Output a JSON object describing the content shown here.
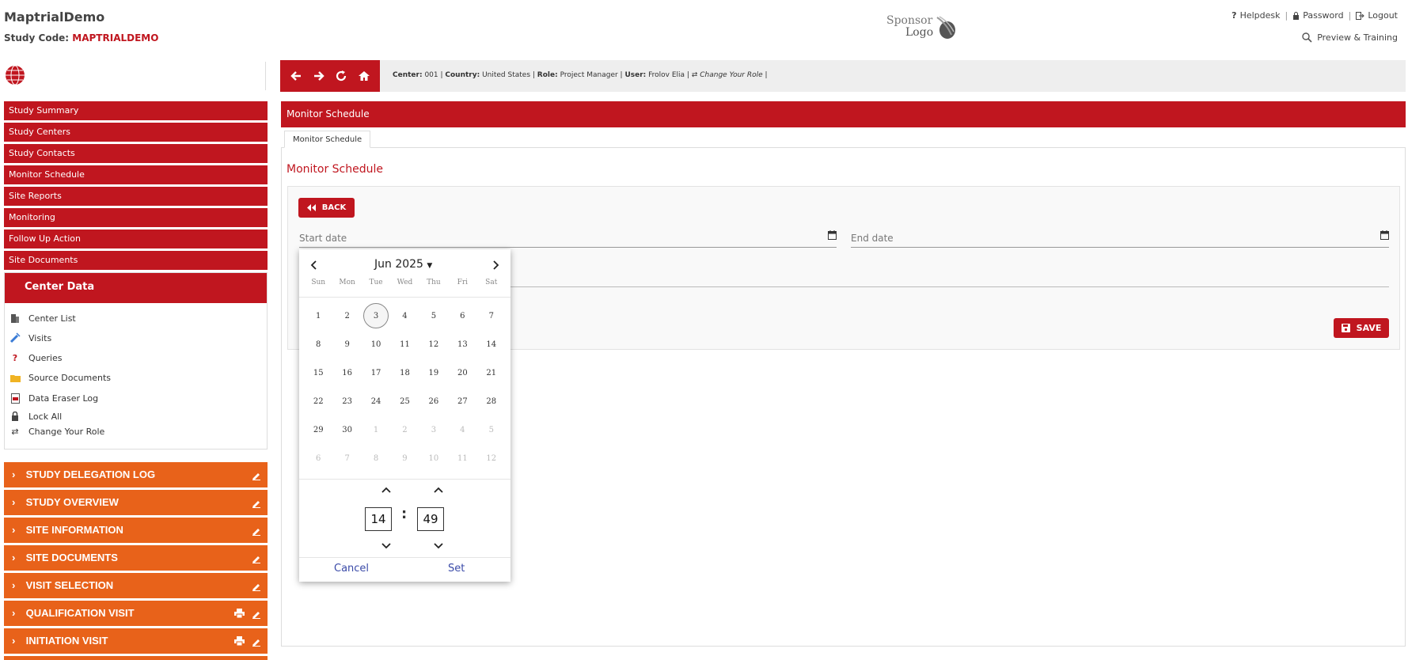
{
  "header": {
    "app_title": "MaptrialDemo",
    "study_code_label": "Study Code:",
    "study_code": "MAPTRIALDEMO",
    "sponsor_line1": "Sponsor",
    "sponsor_line2": "Logo",
    "links": {
      "helpdesk": "Helpdesk",
      "password": "Password",
      "logout": "Logout"
    },
    "preview": "Preview & Training"
  },
  "toolbar": {
    "center_label": "Center:",
    "center": "001",
    "country_label": "Country:",
    "country": "United States",
    "role_label": "Role:",
    "role": "Project Manager",
    "user_label": "User:",
    "user": "Frolov Elia",
    "change_role": "Change Your Role"
  },
  "sidebar": {
    "items": [
      {
        "label": "Study Summary"
      },
      {
        "label": "Study Centers"
      },
      {
        "label": "Study Contacts"
      },
      {
        "label": "Monitor Schedule"
      },
      {
        "label": "Site Reports"
      },
      {
        "label": "Monitoring"
      },
      {
        "label": "Follow Up Action"
      },
      {
        "label": "Site Documents"
      }
    ],
    "center_data": {
      "title": "Center Data",
      "items": [
        {
          "label": "Center List",
          "icon": "building-icon"
        },
        {
          "label": "Visits",
          "icon": "syringe-icon"
        },
        {
          "label": "Queries",
          "icon": "question-icon"
        },
        {
          "label": "Source Documents",
          "icon": "folder-icon"
        },
        {
          "label": "Data Eraser Log",
          "icon": "pdf-icon"
        },
        {
          "label": "Lock All",
          "icon": "lock-icon"
        },
        {
          "label": "Change Your Role",
          "icon": "exchange-icon"
        }
      ]
    },
    "sections": [
      {
        "label": "STUDY DELEGATION LOG"
      },
      {
        "label": "STUDY OVERVIEW"
      },
      {
        "label": "SITE INFORMATION"
      },
      {
        "label": "SITE DOCUMENTS"
      },
      {
        "label": "VISIT SELECTION"
      },
      {
        "label": "QUALIFICATION VISIT"
      },
      {
        "label": "INITIATION VISIT"
      }
    ]
  },
  "main": {
    "header": "Monitor Schedule",
    "tab": "Monitor Schedule",
    "section_title": "Monitor Schedule",
    "back_label": "BACK",
    "start_date_placeholder": "Start date",
    "end_date_placeholder": "End date",
    "save_label": "SAVE"
  },
  "datepicker": {
    "month_label": "Jun 2025",
    "weekdays": [
      "Sun",
      "Mon",
      "Tue",
      "Wed",
      "Thu",
      "Fri",
      "Sat"
    ],
    "selected_day": "3",
    "days": [
      {
        "d": "1"
      },
      {
        "d": "2"
      },
      {
        "d": "3",
        "today": true
      },
      {
        "d": "4"
      },
      {
        "d": "5"
      },
      {
        "d": "6"
      },
      {
        "d": "7"
      },
      {
        "d": "8"
      },
      {
        "d": "9"
      },
      {
        "d": "10"
      },
      {
        "d": "11"
      },
      {
        "d": "12"
      },
      {
        "d": "13"
      },
      {
        "d": "14"
      },
      {
        "d": "15"
      },
      {
        "d": "16"
      },
      {
        "d": "17"
      },
      {
        "d": "18"
      },
      {
        "d": "19"
      },
      {
        "d": "20"
      },
      {
        "d": "21"
      },
      {
        "d": "22"
      },
      {
        "d": "23"
      },
      {
        "d": "24"
      },
      {
        "d": "25"
      },
      {
        "d": "26"
      },
      {
        "d": "27"
      },
      {
        "d": "28"
      },
      {
        "d": "29"
      },
      {
        "d": "30"
      },
      {
        "d": "1",
        "muted": true
      },
      {
        "d": "2",
        "muted": true
      },
      {
        "d": "3",
        "muted": true
      },
      {
        "d": "4",
        "muted": true
      },
      {
        "d": "5",
        "muted": true
      },
      {
        "d": "6",
        "muted": true
      },
      {
        "d": "7",
        "muted": true
      },
      {
        "d": "8",
        "muted": true
      },
      {
        "d": "9",
        "muted": true
      },
      {
        "d": "10",
        "muted": true
      },
      {
        "d": "11",
        "muted": true
      },
      {
        "d": "12",
        "muted": true
      }
    ],
    "hour": "14",
    "minute": "49",
    "cancel_label": "Cancel",
    "set_label": "Set"
  },
  "colors": {
    "brand_red": "#c0161f",
    "accent_orange": "#e8621a",
    "link_blue": "#3a4aa8"
  }
}
